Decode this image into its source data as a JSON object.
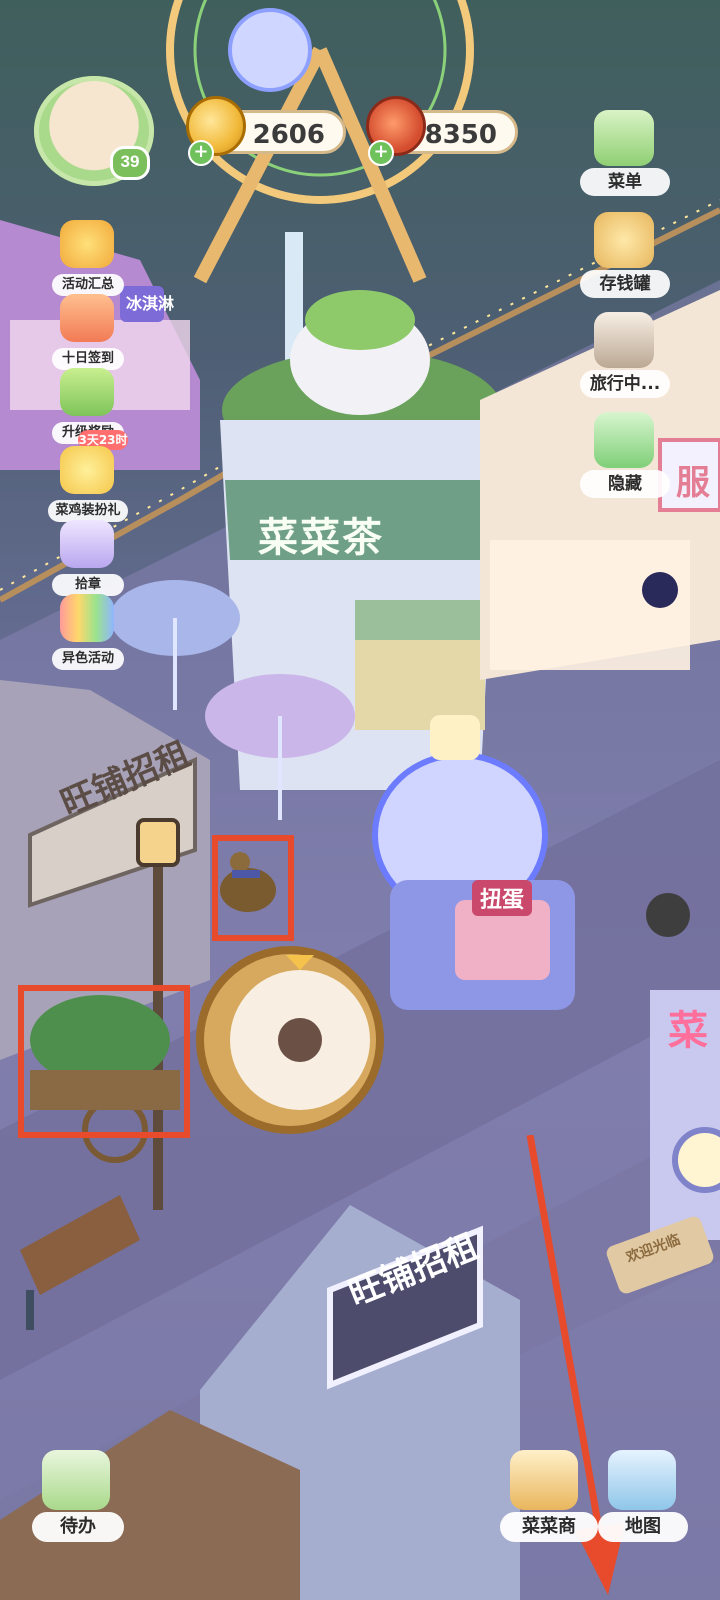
{
  "hud": {
    "level": "39",
    "coins": "2606",
    "veggies": "8350"
  },
  "left_menu": [
    {
      "label": "活动汇总",
      "icon": "crown-icon"
    },
    {
      "label": "十日签到",
      "icon": "calendar-gift-icon"
    },
    {
      "label": "升级奖励",
      "icon": "upgrade-arrows-icon"
    },
    {
      "label": "菜鸡装扮礼",
      "icon": "duck-costume-icon",
      "tag": "3天23时"
    },
    {
      "label": "拾章",
      "icon": "sticker-book-icon"
    },
    {
      "label": "异色活动",
      "icon": "rainbow-card-icon"
    }
  ],
  "right_menu": [
    {
      "label": "菜单",
      "icon": "menu-board-icon"
    },
    {
      "label": "存钱罐",
      "icon": "piggy-bank-icon"
    },
    {
      "label": "旅行中...",
      "icon": "camera-icon"
    },
    {
      "label": "隐藏",
      "icon": "hide-frame-icon"
    }
  ],
  "bottom_menu": [
    {
      "label": "待办",
      "icon": "todo-list-icon"
    },
    {
      "label": "菜菜商",
      "icon": "shop-icon"
    },
    {
      "label": "地图",
      "icon": "map-icon"
    }
  ],
  "signs": {
    "tea_shop": "菜菜茶",
    "rent_sign_1": "旺铺招租",
    "rent_sign_2": "旺铺招租",
    "icecream_sign": "冰淇淋",
    "gacha_sign": "扭蛋",
    "dress_shop_sign": "服",
    "laundry_sign": "菜",
    "welcome_mat": "欢迎光临"
  },
  "colors": {
    "annotation_red": "#e84a2c",
    "coin_gold": "#f1b93a",
    "tea_green": "#8fca6a"
  }
}
